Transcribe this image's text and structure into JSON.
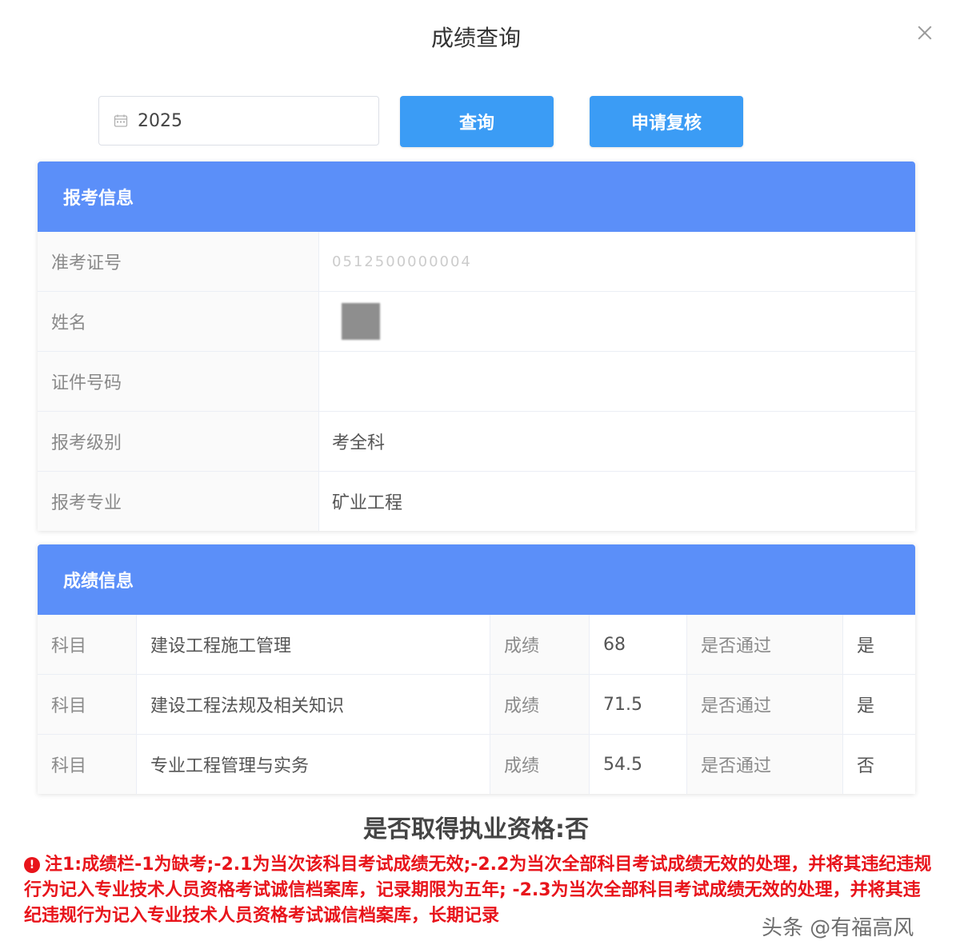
{
  "dialog": {
    "title": "成绩查询"
  },
  "toolbar": {
    "year_value": "2025",
    "query_label": "查询",
    "review_label": "申请复核"
  },
  "registration": {
    "header": "报考信息",
    "rows": [
      {
        "label": "准考证号",
        "value": "0512500000004"
      },
      {
        "label": "姓名",
        "value": ""
      },
      {
        "label": "证件号码",
        "value": ""
      },
      {
        "label": "报考级别",
        "value": "考全科"
      },
      {
        "label": "报考专业",
        "value": "矿业工程"
      }
    ]
  },
  "scores": {
    "header": "成绩信息",
    "subject_label": "科目",
    "score_label": "成绩",
    "pass_label": "是否通过",
    "rows": [
      {
        "subject": "建设工程施工管理",
        "score": "68",
        "passed": "是"
      },
      {
        "subject": "建设工程法规及相关知识",
        "score": "71.5",
        "passed": "是"
      },
      {
        "subject": "专业工程管理与实务",
        "score": "54.5",
        "passed": "否"
      }
    ]
  },
  "qualification": "是否取得执业资格:否",
  "note": "注1:成绩栏-1为缺考;-2.1为当次该科目考试成绩无效;-2.2为当次全部科目考试成绩无效的处理，并将其违纪违规行为记入专业技术人员资格考试诚信档案库，记录期限为五年; -2.3为当次全部科目考试成绩无效的处理，并将其违纪违规行为记入专业技术人员资格考试诚信档案库，长期记录",
  "watermark": "头条 @有福高风",
  "colors": {
    "primary_button": "#3b9cf5",
    "header_bar": "#5b8ff9",
    "note": "#e8141b"
  }
}
